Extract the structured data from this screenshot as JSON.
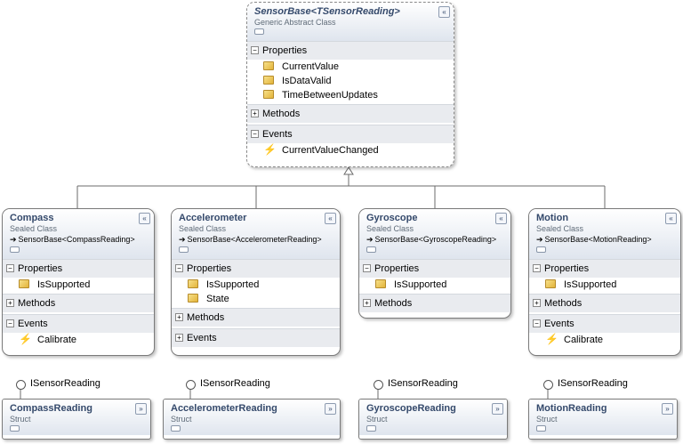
{
  "base_class": {
    "title": "SensorBase<TSensorReading>",
    "kind": "Generic Abstract Class",
    "sections": {
      "properties": "Properties",
      "methods": "Methods",
      "events": "Events"
    },
    "properties": [
      "CurrentValue",
      "IsDataValid",
      "TimeBetweenUpdates"
    ],
    "events": [
      "CurrentValueChanged"
    ]
  },
  "classes": [
    {
      "title": "Compass",
      "kind": "Sealed Class",
      "base": "SensorBase<CompassReading>",
      "properties_label": "Properties",
      "properties": [
        "IsSupported"
      ],
      "methods_label": "Methods",
      "events_label": "Events",
      "events": [
        "Calibrate"
      ]
    },
    {
      "title": "Accelerometer",
      "kind": "Sealed Class",
      "base": "SensorBase<AccelerometerReading>",
      "properties_label": "Properties",
      "properties": [
        "IsSupported",
        "State"
      ],
      "methods_label": "Methods",
      "events_label": "Events"
    },
    {
      "title": "Gyroscope",
      "kind": "Sealed Class",
      "base": "SensorBase<GyroscopeReading>",
      "properties_label": "Properties",
      "properties": [
        "IsSupported"
      ],
      "methods_label": "Methods"
    },
    {
      "title": "Motion",
      "kind": "Sealed Class",
      "base": "SensorBase<MotionReading>",
      "properties_label": "Properties",
      "properties": [
        "IsSupported"
      ],
      "methods_label": "Methods",
      "events_label": "Events",
      "events": [
        "Calibrate"
      ]
    }
  ],
  "structs": [
    {
      "interface": "ISensorReading",
      "title": "CompassReading",
      "kind": "Struct"
    },
    {
      "interface": "ISensorReading",
      "title": "AccelerometerReading",
      "kind": "Struct"
    },
    {
      "interface": "ISensorReading",
      "title": "GyroscopeReading",
      "kind": "Struct"
    },
    {
      "interface": "ISensorReading",
      "title": "MotionReading",
      "kind": "Struct"
    }
  ],
  "glyphs": {
    "collapse": "«",
    "expand": "»",
    "minus": "−",
    "plus": "+",
    "inherit_arrow": "➔",
    "event": "⚡"
  }
}
